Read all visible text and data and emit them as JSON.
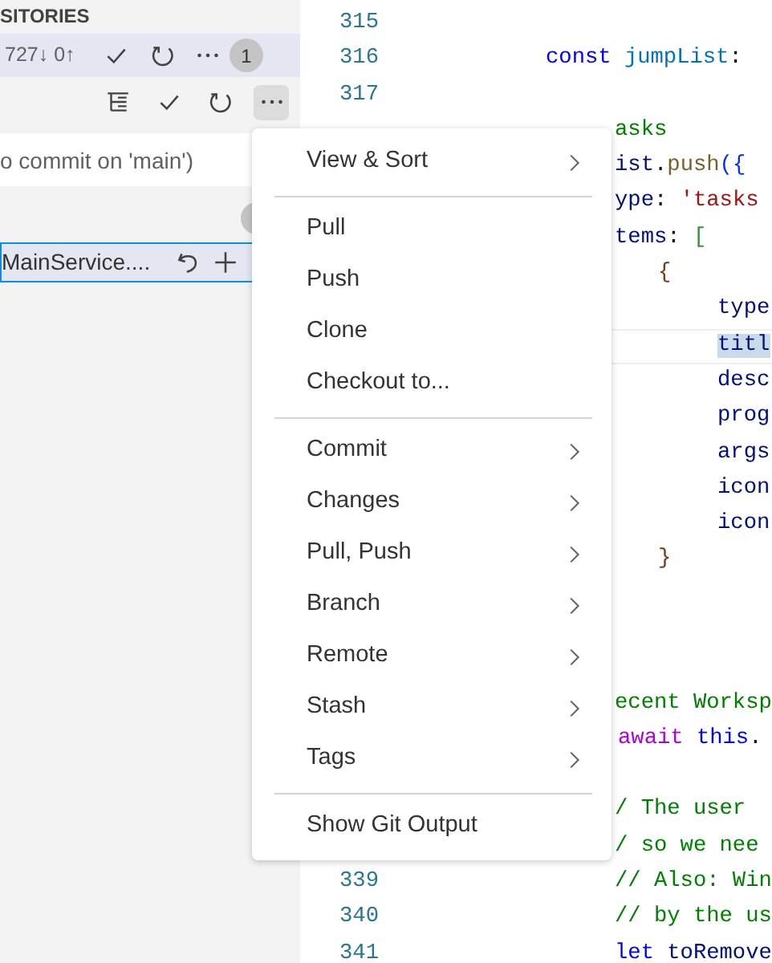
{
  "sidebar": {
    "section_title": "SITORIES",
    "repository": {
      "sync_status": "727↓ 0↑",
      "badge": "1",
      "selected": true
    },
    "scm_toolbar": [
      {
        "kind": "tree",
        "active": false
      },
      {
        "kind": "check",
        "active": false
      },
      {
        "kind": "refresh",
        "active": false
      },
      {
        "kind": "more",
        "active": true
      }
    ],
    "commit_message": {
      "placeholder": "o commit on 'main')"
    },
    "changes": [
      {
        "file": "MainService....",
        "selected": true
      }
    ]
  },
  "editor": {
    "lines": [
      {
        "number": "315"
      },
      {
        "number": "316",
        "segments": [
          {
            "text": "const",
            "color": "#0000ff"
          },
          {
            "text": " jumpList",
            "color": "#0070c1"
          },
          {
            "text": ":",
            "color": "#000000"
          }
        ]
      },
      {
        "number": "317"
      },
      {
        "segments": [
          {
            "text": "asks",
            "color": "#008000"
          }
        ]
      },
      {
        "segments": [
          {
            "text": "ist",
            "color": "#001080"
          },
          {
            "text": ".",
            "color": "#000000"
          },
          {
            "text": "push",
            "color": "#795e26"
          },
          {
            "text": "({",
            "color": "#0431fa"
          }
        ]
      },
      {
        "segments": [
          {
            "text": "ype",
            "color": "#001080"
          },
          {
            "text": ": ",
            "color": "#000000"
          },
          {
            "text": "'tasks",
            "color": "#a31515"
          }
        ]
      },
      {
        "segments": [
          {
            "text": "tems",
            "color": "#001080"
          },
          {
            "text": ": ",
            "color": "#000000"
          },
          {
            "text": "[",
            "color": "#319331"
          }
        ]
      },
      {
        "segments": [
          {
            "text": "{",
            "color": "#7b3814"
          }
        ]
      },
      {
        "segments": [
          {
            "text": "type",
            "color": "#001080"
          }
        ]
      },
      {
        "current": true,
        "segments": [
          {
            "text": "titl",
            "color": "#001080",
            "highlighted": true
          }
        ]
      },
      {
        "segments": [
          {
            "text": "desc",
            "color": "#001080"
          }
        ]
      },
      {
        "segments": [
          {
            "text": "prog",
            "color": "#001080"
          }
        ]
      },
      {
        "segments": [
          {
            "text": "args",
            "color": "#001080"
          }
        ]
      },
      {
        "segments": [
          {
            "text": "icon",
            "color": "#001080"
          }
        ]
      },
      {
        "segments": [
          {
            "text": "icon",
            "color": "#001080"
          }
        ]
      },
      {
        "segments": [
          {
            "text": "}",
            "color": "#7b3814"
          }
        ]
      },
      {
        "segments": [
          {
            "text": "ecent Worksp",
            "color": "#008000"
          }
        ]
      },
      {
        "segments": [
          {
            "text": "await",
            "color": "#af00db"
          },
          {
            "text": " this",
            "color": "#0000ff"
          },
          {
            "text": ".",
            "color": "#000000"
          }
        ]
      },
      {
        "segments": [
          {
            "text": "/ The user",
            "color": "#008000"
          }
        ]
      },
      {
        "segments": [
          {
            "text": "/ so we nee",
            "color": "#008000"
          }
        ]
      },
      {
        "number": "339",
        "segments": [
          {
            "text": "// Also: Win",
            "color": "#008000"
          }
        ]
      },
      {
        "number": "340",
        "segments": [
          {
            "text": "// by the us",
            "color": "#008000"
          }
        ]
      },
      {
        "number": "341",
        "segments": [
          {
            "text": "let",
            "color": "#0000ff"
          },
          {
            "text": " toRemove",
            "color": "#001080"
          }
        ]
      }
    ]
  },
  "context_menu": {
    "items": [
      {
        "kind": "item",
        "label": "View & Sort",
        "submenu": true
      },
      {
        "kind": "separator"
      },
      {
        "kind": "item",
        "label": "Pull",
        "submenu": false
      },
      {
        "kind": "item",
        "label": "Push",
        "submenu": false
      },
      {
        "kind": "item",
        "label": "Clone",
        "submenu": false
      },
      {
        "kind": "item",
        "label": "Checkout to...",
        "submenu": false
      },
      {
        "kind": "separator"
      },
      {
        "kind": "item",
        "label": "Commit",
        "submenu": true
      },
      {
        "kind": "item",
        "label": "Changes",
        "submenu": true
      },
      {
        "kind": "item",
        "label": "Pull, Push",
        "submenu": true
      },
      {
        "kind": "item",
        "label": "Branch",
        "submenu": true
      },
      {
        "kind": "item",
        "label": "Remote",
        "submenu": true
      },
      {
        "kind": "item",
        "label": "Stash",
        "submenu": true
      },
      {
        "kind": "item",
        "label": "Tags",
        "submenu": true
      },
      {
        "kind": "separator"
      },
      {
        "kind": "item",
        "label": "Show Git Output",
        "submenu": false
      }
    ]
  }
}
